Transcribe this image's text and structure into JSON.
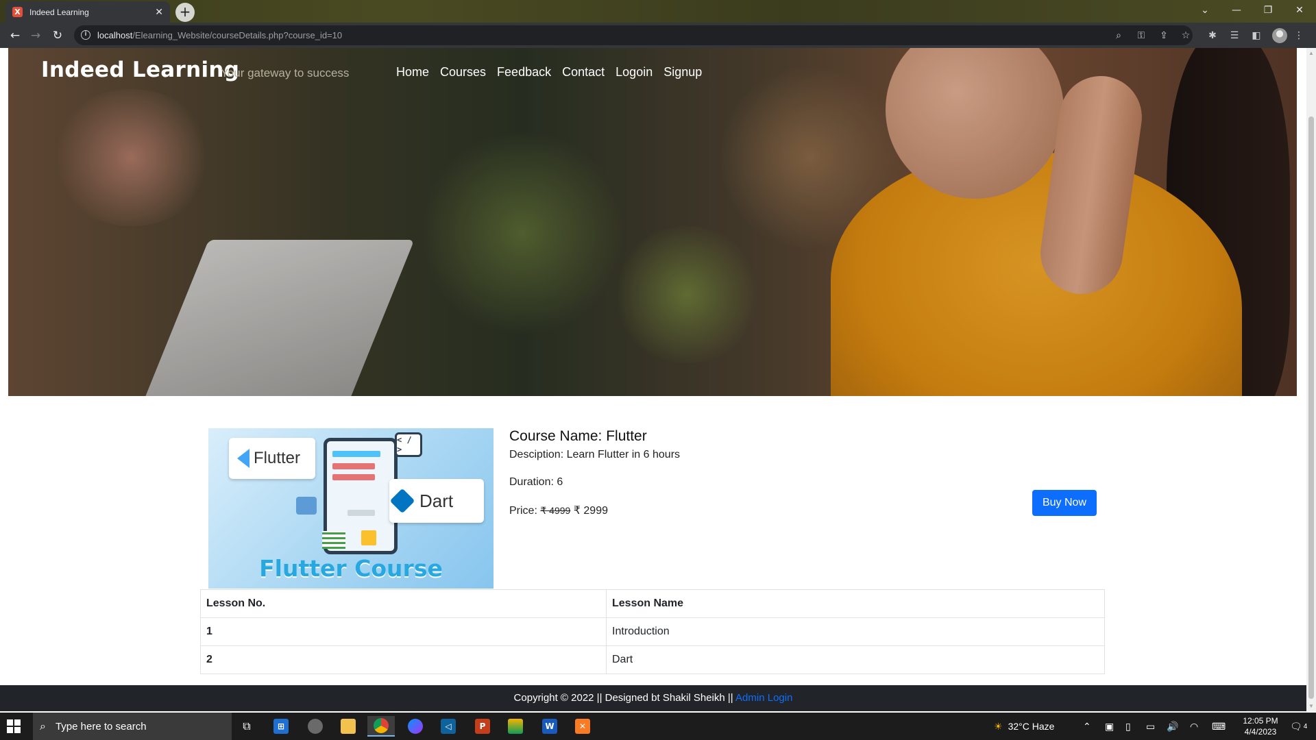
{
  "browser": {
    "tab_title": "Indeed Learning",
    "tab_favicon": "X",
    "url_host": "localhost",
    "url_path": "/Elearning_Website/courseDetails.php?course_id=10"
  },
  "site": {
    "brand": "Indeed Learning",
    "tagline": "Your gateway to success",
    "nav": [
      "Home",
      "Courses",
      "Feedback",
      "Contact",
      "Logoin",
      "Signup"
    ]
  },
  "course": {
    "image_text": {
      "flutter": "Flutter",
      "dart": "Dart",
      "code": "< / >",
      "caption": "Flutter Course"
    },
    "name": "Course Name: Flutter",
    "description": "Desciption: Learn Flutter in 6 hours",
    "duration": "Duration: 6",
    "price_label": "Price:",
    "old_price": "₹ 4999",
    "new_price": "₹ 2999",
    "buy_label": "Buy Now"
  },
  "lessons": {
    "headers": [
      "Lesson No.",
      "Lesson Name"
    ],
    "rows": [
      [
        "1",
        "Introduction"
      ],
      [
        "2",
        "Dart"
      ]
    ]
  },
  "footer": {
    "text": "Copyright © 2022 || Designed bt Shakil Sheikh || ",
    "admin_link": "Admin Login"
  },
  "taskbar": {
    "search_placeholder": "Type here to search",
    "weather": "32°C  Haze",
    "time": "12:05 PM",
    "date": "4/4/2023",
    "notification_count": "4"
  },
  "colors": {
    "accent": "#0d6efd",
    "footer_bg": "#212529",
    "chrome_bg": "#35363a"
  }
}
